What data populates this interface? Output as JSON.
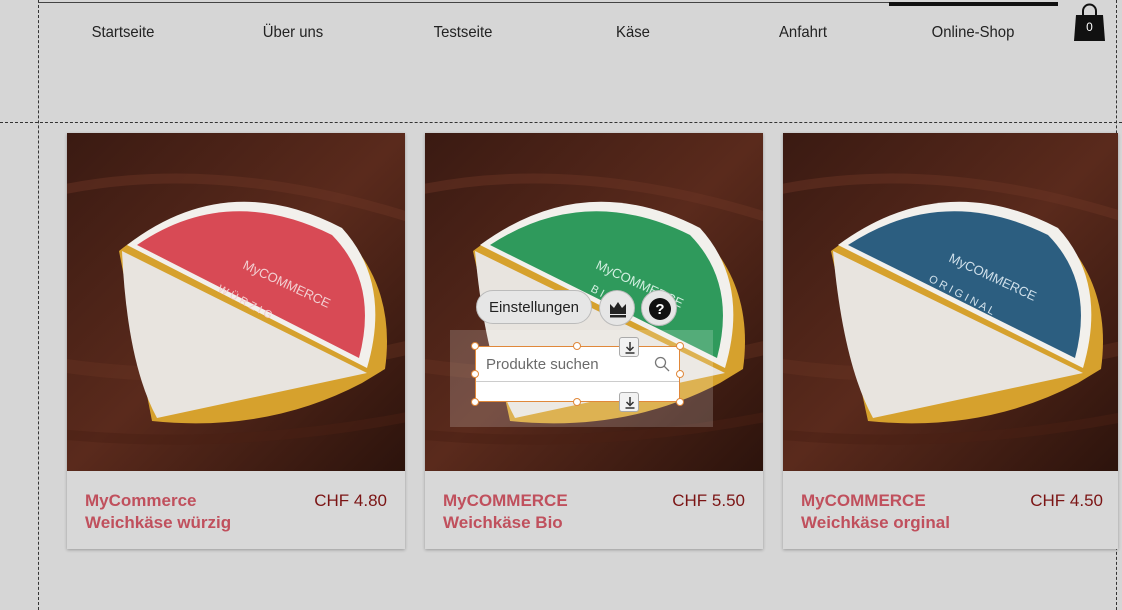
{
  "nav": {
    "items": [
      {
        "label": "Startseite"
      },
      {
        "label": "Über uns"
      },
      {
        "label": "Testseite"
      },
      {
        "label": "Käse"
      },
      {
        "label": "Anfahrt"
      },
      {
        "label": "Online-Shop",
        "active": true
      }
    ],
    "cart_count": "0"
  },
  "products": [
    {
      "name_line1": "MyCommerce",
      "name_line2": "Weichkäse würzig",
      "price": "CHF 4.80",
      "label_color": "#d84a55",
      "label_word": "WÜRZIG",
      "brand": "MyCOMMERCE"
    },
    {
      "name_line1": "MyCOMMERCE",
      "name_line2": "Weichkäse Bio",
      "price": "CHF 5.50",
      "label_color": "#2f9a5c",
      "label_word": "BIO",
      "brand": "MyCOMMERCE"
    },
    {
      "name_line1": "MyCOMMERCE",
      "name_line2": "Weichkäse orginal",
      "price": "CHF 4.50",
      "label_color": "#2c5e80",
      "label_word": "ORIGINAL",
      "brand": "MyCOMMERCE"
    }
  ],
  "editor": {
    "settings_label": "Einstellungen",
    "search_placeholder": "Produkte suchen",
    "crown_icon": "crown-icon",
    "help_icon": "help-icon"
  },
  "colors": {
    "accent_orange": "#e0883a",
    "product_name": "#c0505d",
    "price": "#7b1414"
  }
}
